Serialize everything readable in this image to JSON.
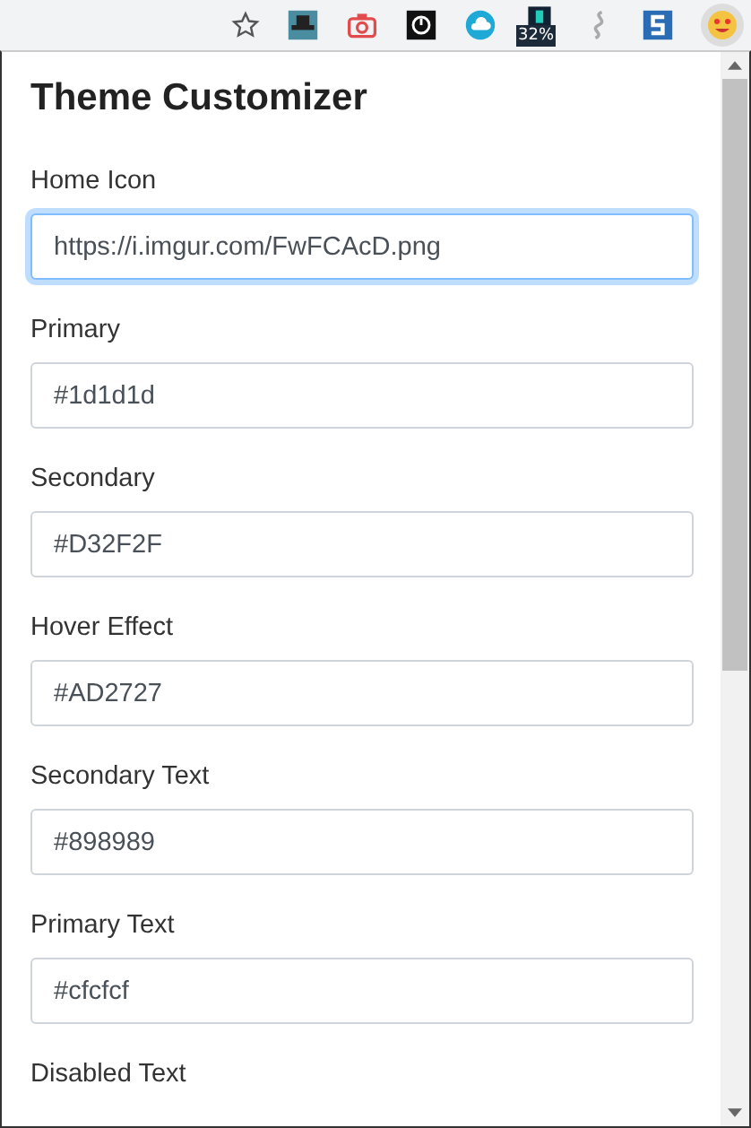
{
  "toolbar": {
    "badge": "32%"
  },
  "title": "Theme Customizer",
  "fields": [
    {
      "label": "Home Icon",
      "value": "https://i.imgur.com/FwFCAcD.png",
      "focused": true
    },
    {
      "label": "Primary",
      "value": "#1d1d1d",
      "focused": false
    },
    {
      "label": "Secondary",
      "value": "#D32F2F",
      "focused": false
    },
    {
      "label": "Hover Effect",
      "value": "#AD2727",
      "focused": false
    },
    {
      "label": "Secondary Text",
      "value": "#898989",
      "focused": false
    },
    {
      "label": "Primary Text",
      "value": "#cfcfcf",
      "focused": false
    },
    {
      "label": "Disabled Text"
    }
  ]
}
